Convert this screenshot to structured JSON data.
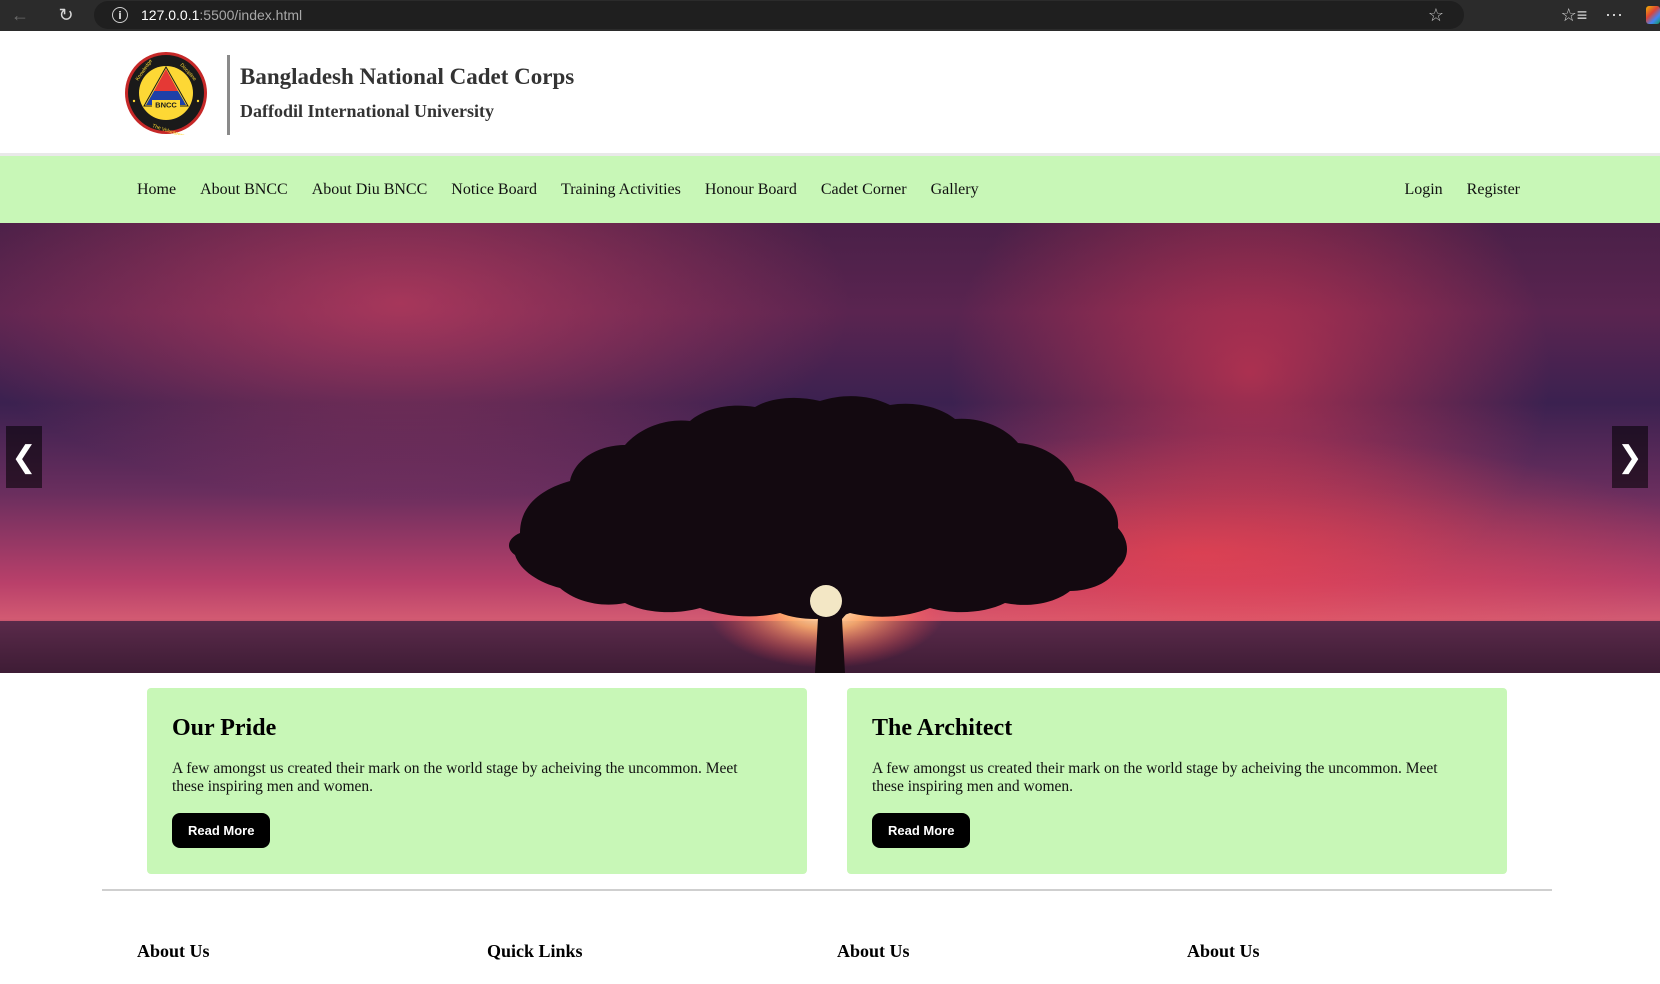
{
  "browser": {
    "url_host": "127.0.0.1",
    "url_path": ":5500/index.html"
  },
  "header": {
    "title": "Bangladesh National Cadet Corps",
    "subtitle": "Daffodil International University",
    "logo_text": "BNCC",
    "logo_ring_text": "Knowledge & Discipline",
    "logo_ring_text_bottom": "The Volunteers"
  },
  "nav": {
    "left": [
      "Home",
      "About BNCC",
      "About Diu BNCC",
      "Notice Board",
      "Training Activities",
      "Honour Board",
      "Cadet Corner",
      "Gallery"
    ],
    "right": [
      "Login",
      "Register"
    ]
  },
  "slider": {
    "prev_label": "❮",
    "next_label": "❯"
  },
  "cards": [
    {
      "title": "Our Pride",
      "text": "A few amongst us created their mark on the world stage by acheiving the uncommon. Meet these inspiring men and women.",
      "button": "Read More"
    },
    {
      "title": "The Architect",
      "text": "A few amongst us created their mark on the world stage by acheiving the uncommon. Meet these inspiring men and women.",
      "button": "Read More"
    }
  ],
  "footer": {
    "headings": [
      "About Us",
      "Quick Links",
      "About Us",
      "About Us"
    ]
  },
  "colors": {
    "nav_bg": "#c8f7b7",
    "card_bg": "#c8f7b7",
    "button_bg": "#000000"
  },
  "icons": {
    "back": "arrow-left-icon",
    "reload": "reload-icon",
    "info": "info-icon",
    "star": "star-icon",
    "favorites": "favorites-icon",
    "more": "more-icon"
  }
}
